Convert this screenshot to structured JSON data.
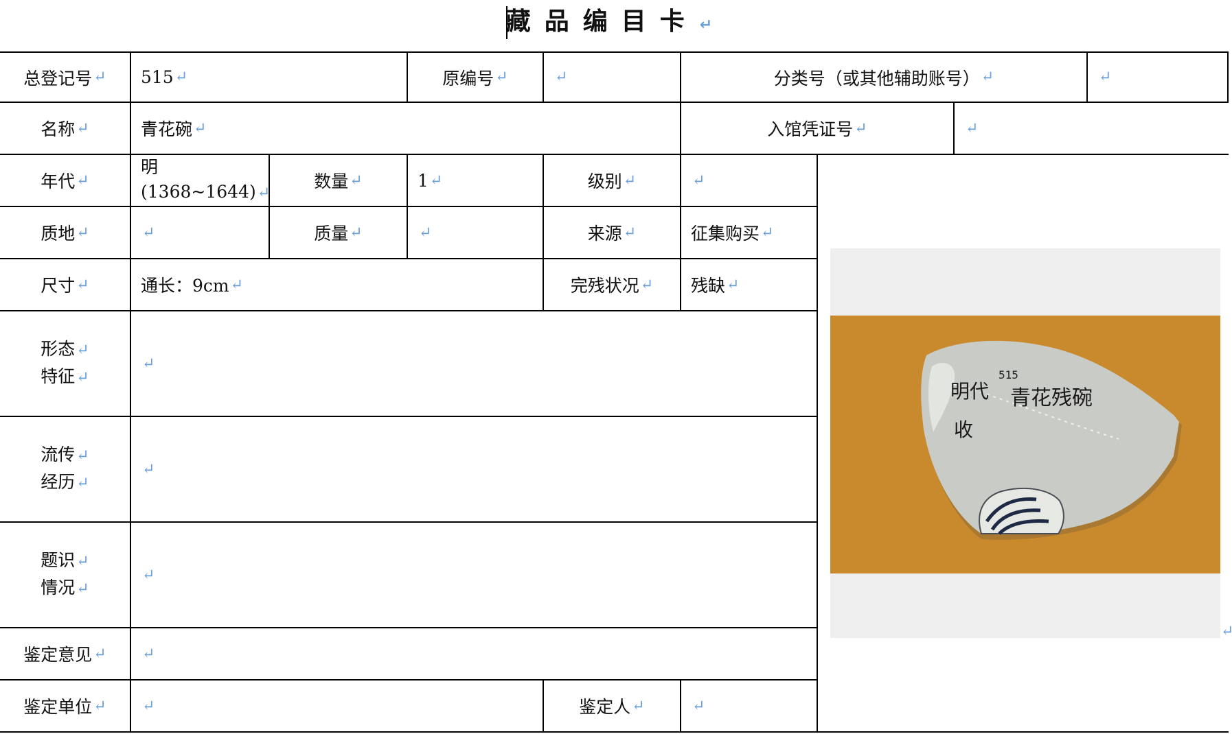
{
  "title": "藏品编目卡",
  "return_mark": "↵",
  "labels": {
    "zongdengji": "总登记号",
    "yuanbianhao": "原编号",
    "fenleihao": "分类号（或其他辅助账号）",
    "mingcheng": "名称",
    "ruguan": "入馆凭证号",
    "niandai": "年代",
    "shuliang": "数量",
    "jibie": "级别",
    "zhidi": "质地",
    "zhiliang": "质量",
    "laiyuan": "来源",
    "chicun": "尺寸",
    "wancan": "完残状况",
    "xingtai": [
      "形态",
      "特征"
    ],
    "liuchuan": [
      "流传",
      "经历"
    ],
    "tishi": [
      "题识",
      "情况"
    ],
    "jianding_yijian": "鉴定意见",
    "jianding_danwei": "鉴定单位",
    "jianding_ren": "鉴定人"
  },
  "values": {
    "zongdengji": "515",
    "yuanbianhao": "",
    "fenleihao": "",
    "mingcheng": "青花碗",
    "ruguan": "",
    "niandai_line1": "明",
    "niandai_line2": "(1368~1644)",
    "shuliang": "1",
    "jibie": "",
    "zhidi": "",
    "zhiliang": "",
    "laiyuan": "征集购买",
    "chicun": "通长：9cm",
    "wancan": "残缺",
    "xingtai": "",
    "liuchuan": "",
    "tishi": "",
    "jianding_yijian": "",
    "jianding_danwei": "",
    "jianding_ren": ""
  },
  "photo": {
    "inscription_number": "515",
    "inscription_line1": "明代",
    "inscription_line2": "青花残碗",
    "inscription_line3": "收",
    "background_color": "#c98a2e",
    "bowl_color": "#c9ccc6"
  }
}
